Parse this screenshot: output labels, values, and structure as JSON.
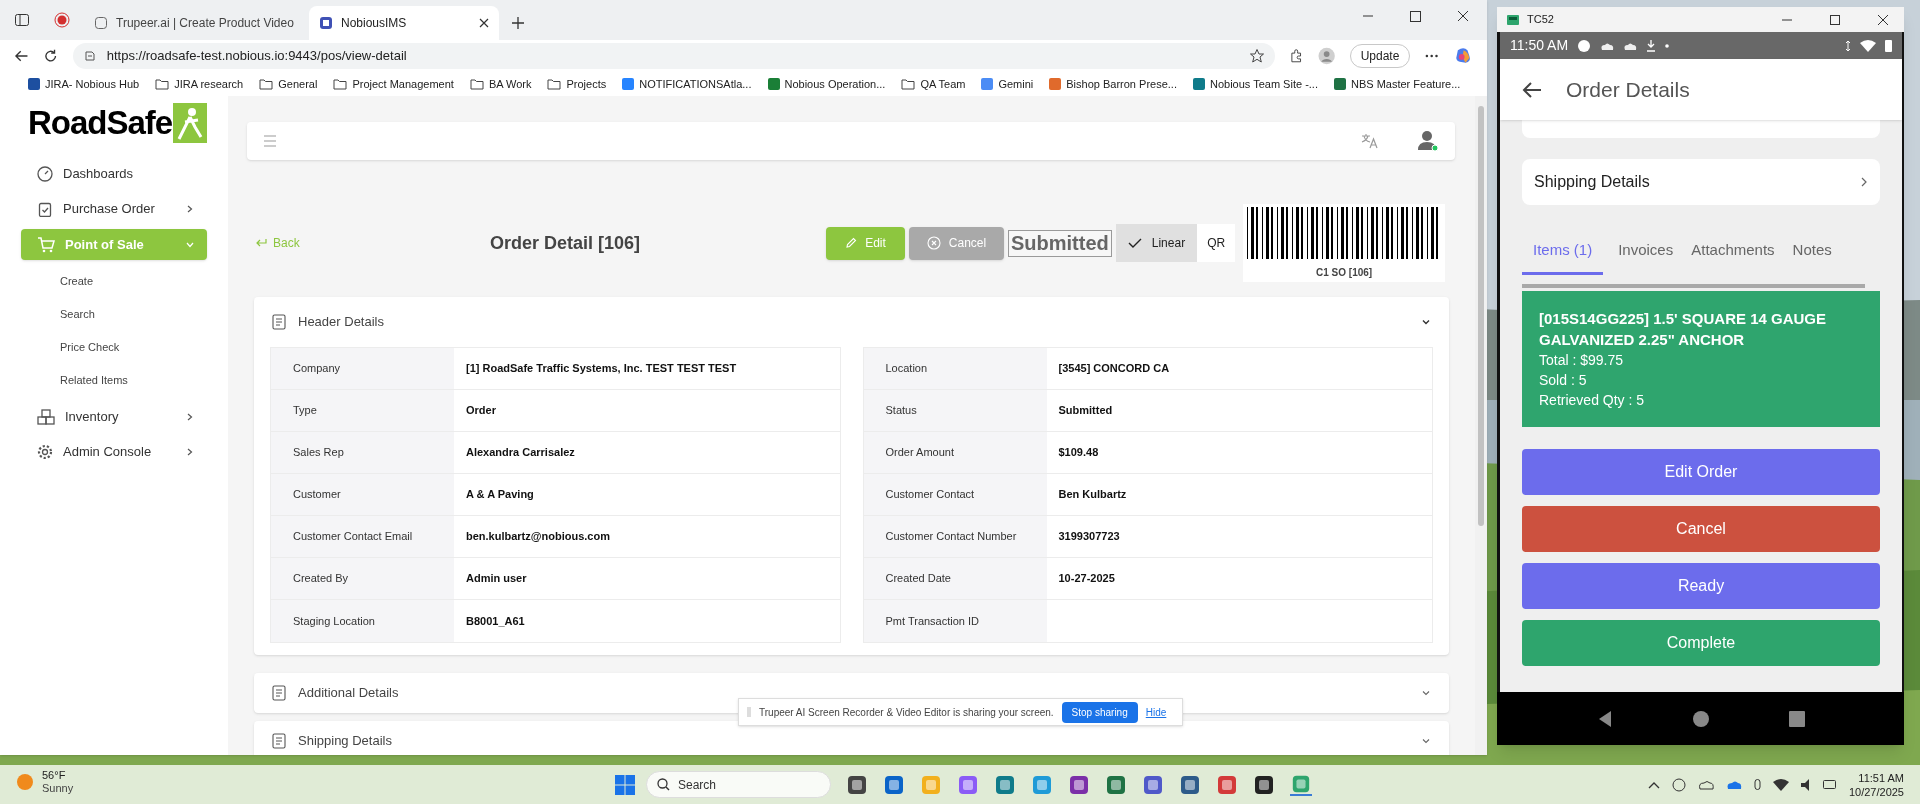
{
  "browser": {
    "tabs": [
      {
        "title": "Trupeer.ai | Create Product Video",
        "selected": false
      },
      {
        "title": "NobiousIMS",
        "selected": true
      }
    ],
    "url": "https://roadsafe-test.nobious.io:9443/pos/view-detail",
    "update_label": "Update",
    "bookmarks": [
      {
        "label": "JIRA- Nobious Hub",
        "kind": "site",
        "color": "#1d4fa0"
      },
      {
        "label": "JIRA research",
        "kind": "folder"
      },
      {
        "label": "General",
        "kind": "folder"
      },
      {
        "label": "Project Management",
        "kind": "folder"
      },
      {
        "label": "BA Work",
        "kind": "folder"
      },
      {
        "label": "Projects",
        "kind": "folder"
      },
      {
        "label": "NOTIFICATIONSAtla...",
        "kind": "site",
        "color": "#2684ff"
      },
      {
        "label": "Nobious Operation...",
        "kind": "site",
        "color": "#1a7f37"
      },
      {
        "label": "QA Team",
        "kind": "folder"
      },
      {
        "label": "Gemini",
        "kind": "site",
        "color": "#4b8cf5"
      },
      {
        "label": "Bishop Barron Prese...",
        "kind": "site",
        "color": "#e06a2c"
      },
      {
        "label": "Nobious Team Site -...",
        "kind": "site",
        "color": "#0f7b8a"
      },
      {
        "label": "NBS Master Feature...",
        "kind": "site",
        "color": "#1f7244"
      }
    ]
  },
  "app": {
    "logo": "RoadSafe",
    "sidebar": [
      {
        "label": "Dashboards",
        "kind": "dashboard",
        "selected": false
      },
      {
        "label": "Purchase Order",
        "kind": "clipboard",
        "selected": false,
        "expanded": false
      },
      {
        "label": "Point of Sale",
        "kind": "cart",
        "selected": true,
        "expanded": true,
        "children": [
          {
            "label": "Create",
            "selected": false
          },
          {
            "label": "Search",
            "selected": false
          },
          {
            "label": "Price Check",
            "selected": false
          },
          {
            "label": "Related Items",
            "selected": false
          }
        ]
      },
      {
        "label": "Inventory",
        "kind": "boxes",
        "selected": false,
        "expanded": false
      },
      {
        "label": "Admin Console",
        "kind": "gear",
        "selected": false,
        "expanded": false
      }
    ],
    "page": {
      "back": "Back",
      "title": "Order Detail [106]",
      "actions": [
        {
          "label": "Edit",
          "kind": "edit",
          "disabled": false
        },
        {
          "label": "Cancel",
          "kind": "cancel",
          "disabled": true
        }
      ],
      "status": "Submitted",
      "barcode_modes": [
        {
          "label": "Linear",
          "selected": true
        },
        {
          "label": "QR",
          "selected": false
        }
      ],
      "barcode_caption": "C1 SO [106]",
      "sections": [
        {
          "title": "Header Details",
          "expanded": true,
          "rows": [
            [
              {
                "label": "Company",
                "value": "[1] RoadSafe Traffic Systems, Inc. TEST TEST TEST"
              },
              {
                "label": "Location",
                "value": "[3545] CONCORD CA"
              }
            ],
            [
              {
                "label": "Type",
                "value": "Order"
              },
              {
                "label": "Status",
                "value": "Submitted"
              }
            ],
            [
              {
                "label": "Sales Rep",
                "value": "Alexandra Carrisalez"
              },
              {
                "label": "Order Amount",
                "value": "$109.48"
              }
            ],
            [
              {
                "label": "Customer",
                "value": "A & A Paving"
              },
              {
                "label": "Customer Contact",
                "value": "Ben Kulbartz"
              }
            ],
            [
              {
                "label": "Customer Contact Email",
                "value": "ben.kulbartz@nobious.com"
              },
              {
                "label": "Customer Contact Number",
                "value": "3199307723"
              }
            ],
            [
              {
                "label": "Created By",
                "value": "Admin user"
              },
              {
                "label": "Created Date",
                "value": "10-27-2025"
              }
            ],
            [
              {
                "label": "Staging Location",
                "value": "B8001_A61"
              },
              {
                "label": "Pmt Transaction ID"
              }
            ]
          ]
        },
        {
          "title": "Additional Details",
          "expanded": false
        },
        {
          "title": "Shipping Details",
          "expanded": false
        }
      ]
    },
    "share_bar": {
      "message": "Trupeer AI Screen Recorder & Video Editor is sharing your screen.",
      "stop": "Stop sharing",
      "hide": "Hide"
    }
  },
  "phone": {
    "window_title": "TC52",
    "time": "11:50 AM",
    "title": "Order Details",
    "shipping": "Shipping Details",
    "tabs": [
      {
        "label": "Items (1)",
        "selected": true
      },
      {
        "label": "Invoices",
        "selected": false
      },
      {
        "label": "Attachments",
        "selected": false
      },
      {
        "label": "Notes",
        "selected": false
      }
    ],
    "items": [
      {
        "title": "[015S14GG225] 1.5' SQUARE 14 GAUGE GALVANIZED 2.25\" ANCHOR",
        "lines": [
          "Total : $99.75",
          "Sold : 5",
          "Retrieved Qty : 5"
        ]
      }
    ],
    "buttons": [
      {
        "label": "Edit Order",
        "color": "#6c6cec"
      },
      {
        "label": "Cancel",
        "color": "#cc513f"
      },
      {
        "label": "Ready",
        "color": "#6c6cec"
      },
      {
        "label": "Complete",
        "color": "#2ea56d"
      }
    ]
  },
  "taskbar": {
    "temperature": "56°F",
    "weather": "Sunny",
    "search": "Search",
    "time": "11:51 AM",
    "date": "10/27/2025"
  }
}
